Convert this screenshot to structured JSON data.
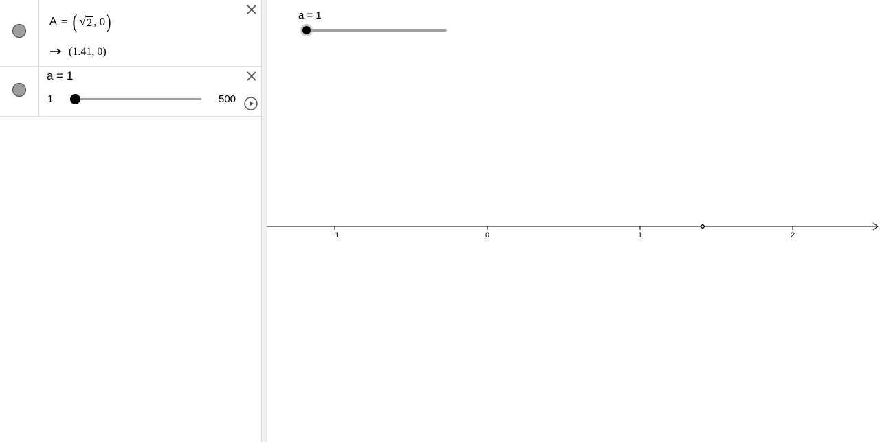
{
  "algebra": {
    "point_row": {
      "label": "A",
      "equals": "=",
      "sqrt_arg": "2",
      "comma_y": ", 0",
      "arrow": "→",
      "value": "(1.41, 0)"
    },
    "slider_row": {
      "definition": "a = 1",
      "min": "1",
      "max": "500",
      "value": 1
    }
  },
  "graphics": {
    "slider_label": "a = 1",
    "x_ticks": [
      "−1",
      "0",
      "1",
      "2"
    ],
    "point_x": 1.41
  },
  "colors": {
    "marble_fill": "#9e9e9e",
    "slider_track": "#a0a0a0",
    "axis": "#000000"
  },
  "icons": [
    "close-icon",
    "play-icon",
    "arrow-right-icon",
    "marble-icon"
  ]
}
